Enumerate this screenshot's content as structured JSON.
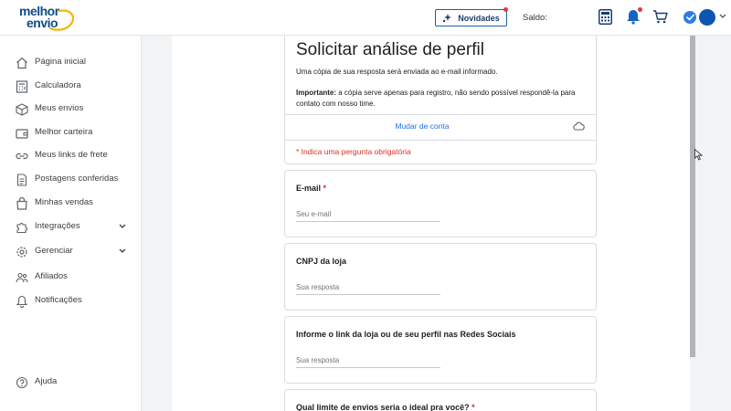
{
  "header": {
    "logo_line1": "melhor",
    "logo_line2": "envio",
    "novidades_label": "Novidades",
    "saldo_label": "Saldo:",
    "icons": [
      "calculator-icon",
      "bell-icon",
      "cart-icon",
      "verified-icon",
      "avatar",
      "chevron-down-icon"
    ]
  },
  "sidebar": {
    "items": [
      {
        "label": "Página inicial",
        "icon": "home-icon"
      },
      {
        "label": "Calculadora",
        "icon": "calculator-icon"
      },
      {
        "label": "Meus envios",
        "icon": "box-icon"
      },
      {
        "label": "Melhor carteira",
        "icon": "wallet-icon"
      },
      {
        "label": "Meus links de frete",
        "icon": "link-icon"
      },
      {
        "label": "Postagens conferidas",
        "icon": "document-icon"
      },
      {
        "label": "Minhas vendas",
        "icon": "bag-icon"
      },
      {
        "label": "Integrações",
        "icon": "puzzle-icon"
      },
      {
        "label": "Gerenciar",
        "icon": "gear-icon"
      },
      {
        "label": "Afiliados",
        "icon": "people-icon"
      },
      {
        "label": "Notificações",
        "icon": "bell-icon"
      }
    ],
    "help_label": "Ajuda"
  },
  "form": {
    "title": "Solicitar análise de perfil",
    "copy_note": "Uma cópia de sua resposta será enviada ao e-mail informado.",
    "important_bold": "Importante:",
    "important_text": " a cópia serve apenas para registro, não sendo possível respondê-la para contato com nosso time.",
    "change_account": "Mudar de conta",
    "required_note": "* Indica uma pergunta obrigatória",
    "questions": [
      {
        "title": "E-mail",
        "required": "*",
        "placeholder": "Seu e-mail"
      },
      {
        "title": "CNPJ da loja",
        "required": "",
        "placeholder": "Sua resposta"
      },
      {
        "title": "Informe o link da loja ou de seu perfil nas Redes Sociais",
        "required": "",
        "placeholder": "Sua resposta"
      },
      {
        "title": "Qual limite de envios seria o ideal pra você?",
        "required": "*",
        "placeholder": ""
      }
    ]
  },
  "colors": {
    "brand_blue": "#0f4c8a",
    "accent_blue": "#1a73e8",
    "required_red": "#d93025",
    "notification_red": "#e53935"
  }
}
